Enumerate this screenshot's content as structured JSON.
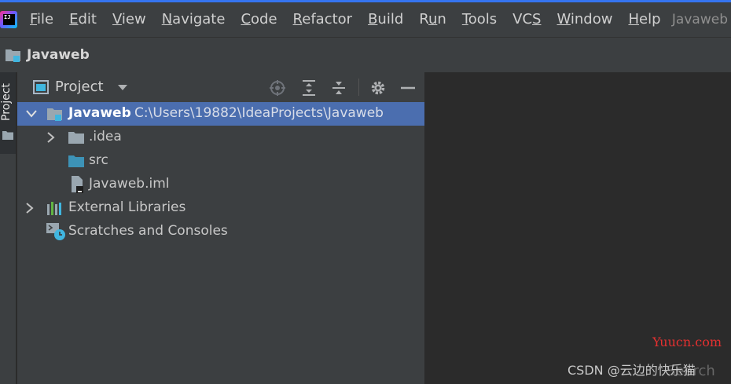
{
  "menubar": {
    "items": [
      {
        "pre": "",
        "ul": "F",
        "post": "ile"
      },
      {
        "pre": "",
        "ul": "E",
        "post": "dit"
      },
      {
        "pre": "",
        "ul": "V",
        "post": "iew"
      },
      {
        "pre": "",
        "ul": "N",
        "post": "avigate"
      },
      {
        "pre": "",
        "ul": "C",
        "post": "ode"
      },
      {
        "pre": "",
        "ul": "R",
        "post": "efactor"
      },
      {
        "pre": "",
        "ul": "B",
        "post": "uild"
      },
      {
        "pre": "R",
        "ul": "u",
        "post": "n"
      },
      {
        "pre": "",
        "ul": "T",
        "post": "ools"
      },
      {
        "pre": "VC",
        "ul": "S",
        "post": ""
      },
      {
        "pre": "",
        "ul": "W",
        "post": "indow"
      },
      {
        "pre": "",
        "ul": "H",
        "post": "elp"
      }
    ],
    "window_title": "Javaweb",
    "logo_text": "IJ"
  },
  "navbar": {
    "project_name": "Javaweb"
  },
  "side_toolwindow": {
    "label": "Project"
  },
  "project_panel": {
    "title": "Project",
    "tree": [
      {
        "name": "Javaweb",
        "path": "C:\\Users\\19882\\IdeaProjects\\Javaweb",
        "icon": "module-folder-icon",
        "expanded": true,
        "selected": true
      },
      {
        "name": ".idea",
        "icon": "folder-icon",
        "expanded": false
      },
      {
        "name": "src",
        "icon": "source-folder-icon"
      },
      {
        "name": "Javaweb.iml",
        "icon": "iml-file-icon"
      },
      {
        "name": "External Libraries",
        "icon": "libraries-icon",
        "expanded": false
      },
      {
        "name": "Scratches and Consoles",
        "icon": "scratches-icon"
      }
    ]
  },
  "watermarks": {
    "site": "Yuucn.com",
    "csdn": "CSDN @云边的快乐猫",
    "search": "Search"
  },
  "colors": {
    "accent": "#3574f0",
    "selection": "#4b6eaf",
    "panel_bg": "#3c3f41",
    "editor_bg": "#2b2b2b"
  }
}
